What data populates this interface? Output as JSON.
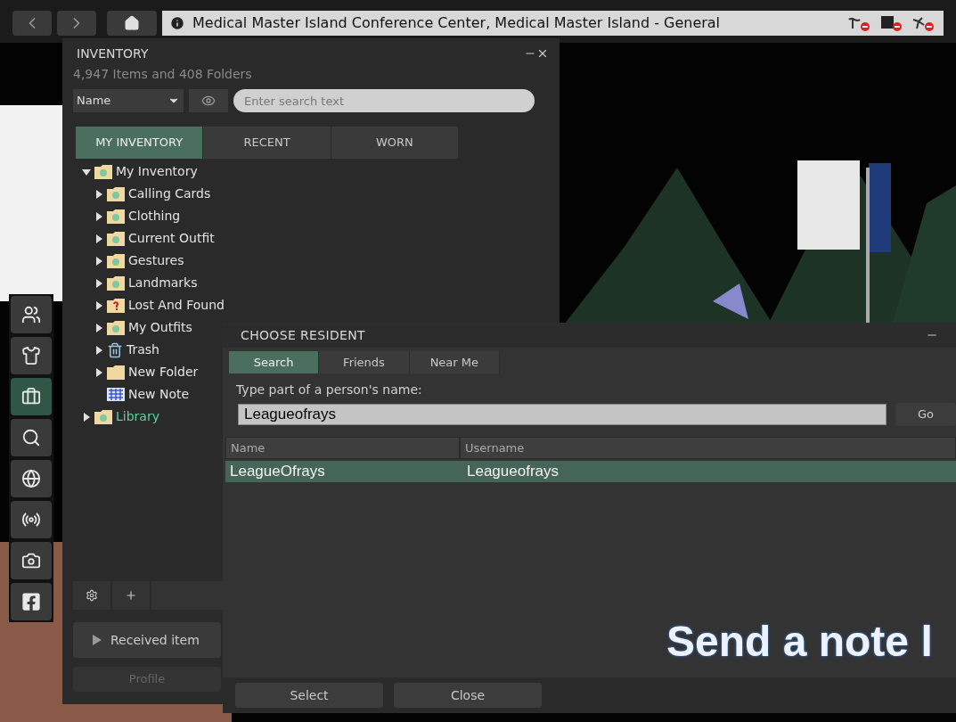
{
  "nav_bar": {
    "location": "Medical Master Island Conference Center, Medical Master Island - General"
  },
  "toolbar": [
    {
      "kind": "people",
      "selected": false
    },
    {
      "kind": "appearance",
      "selected": false
    },
    {
      "kind": "inventory",
      "selected": true
    },
    {
      "kind": "search",
      "selected": false
    },
    {
      "kind": "map",
      "selected": false
    },
    {
      "kind": "voice",
      "selected": false
    },
    {
      "kind": "snapshot",
      "selected": false
    },
    {
      "kind": "facebook",
      "selected": false
    }
  ],
  "inventory": {
    "title": "INVENTORY",
    "count": "4,947 Items and 408 Folders",
    "sort": "Name",
    "search": {
      "placeholder": "Enter search text"
    },
    "tabs": [
      {
        "label": "MY INVENTORY",
        "selected": true
      },
      {
        "label": "RECENT",
        "selected": false
      },
      {
        "label": "WORN",
        "selected": false
      }
    ],
    "tree": [
      {
        "label": "My Inventory",
        "kind": "system",
        "expanded": true,
        "library": false,
        "children": [
          {
            "label": "Calling Cards",
            "kind": "system",
            "expanded": false,
            "library": false
          },
          {
            "label": "Clothing",
            "kind": "system",
            "expanded": false,
            "library": false
          },
          {
            "label": "Current Outfit",
            "kind": "system",
            "expanded": false,
            "library": false
          },
          {
            "label": "Gestures",
            "kind": "system",
            "expanded": false,
            "library": false
          },
          {
            "label": "Landmarks",
            "kind": "system",
            "expanded": false,
            "library": false
          },
          {
            "label": "Lost And Found",
            "kind": "lost_found",
            "expanded": false,
            "library": false
          },
          {
            "label": "My Outfits",
            "kind": "system",
            "expanded": false,
            "library": false
          },
          {
            "label": "Trash",
            "kind": "trash",
            "expanded": false,
            "library": false
          },
          {
            "label": "New Folder",
            "kind": "folder",
            "expanded": false,
            "library": false
          },
          {
            "label": "New Note",
            "kind": "note",
            "library": false
          }
        ]
      },
      {
        "label": "Library",
        "kind": "system",
        "expanded": false,
        "library": true
      }
    ],
    "received_items": "Received item",
    "profile_button": "Profile"
  },
  "choose_resident": {
    "title": "CHOOSE RESIDENT",
    "tabs": [
      {
        "label": "Search",
        "selected": true
      },
      {
        "label": "Friends",
        "selected": false
      },
      {
        "label": "Near Me",
        "selected": false
      }
    ],
    "prompt": "Type part of a person's name:",
    "name_field": {
      "value": "Leagueofrays"
    },
    "go_button": "Go",
    "columns": [
      "Name",
      "Username"
    ],
    "rows": [
      {
        "name": "LeagueOfrays",
        "username": "Leagueofrays",
        "selected": true
      }
    ],
    "buttons": [
      "Select",
      "Close"
    ]
  },
  "caption": "Send a note l"
}
